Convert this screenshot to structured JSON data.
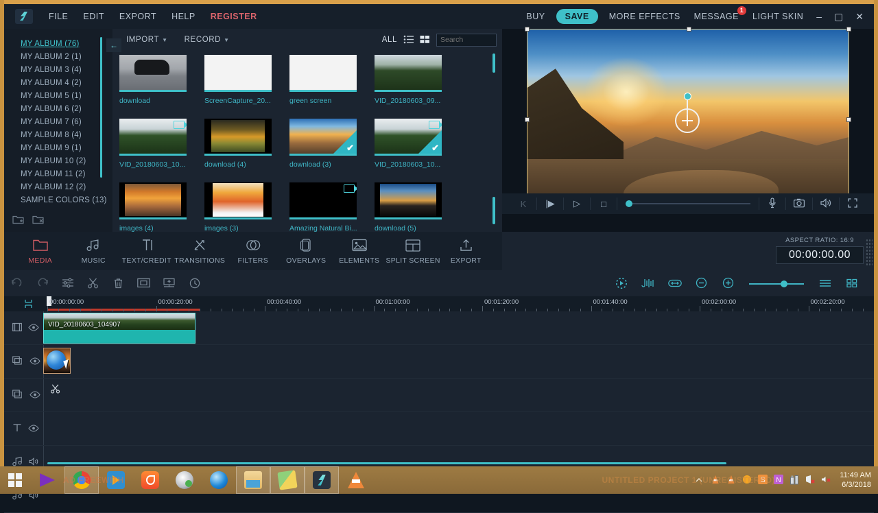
{
  "window": {
    "menu": [
      {
        "label": "FILE",
        "name": "menu-file"
      },
      {
        "label": "EDIT",
        "name": "menu-edit"
      },
      {
        "label": "EXPORT",
        "name": "menu-export"
      },
      {
        "label": "HELP",
        "name": "menu-help"
      },
      {
        "label": "REGISTER",
        "name": "menu-register"
      }
    ],
    "buy": "BUY",
    "save": "SAVE",
    "more_effects": "MORE EFFECTS",
    "message": "MESSAGE",
    "message_badge": "1",
    "light_skin": "LIGHT SKIN",
    "minimize": "–",
    "maximize": "▢",
    "close": "✕",
    "accent": "#3fc0c9",
    "register_color": "#d9636b"
  },
  "albums": {
    "items": [
      {
        "label": "MY ALBUM (76)",
        "active": true
      },
      {
        "label": "MY ALBUM 2 (1)",
        "active": false
      },
      {
        "label": "MY ALBUM 3 (4)",
        "active": false
      },
      {
        "label": "MY ALBUM 4 (2)",
        "active": false
      },
      {
        "label": "MY ALBUM 5 (1)",
        "active": false
      },
      {
        "label": "MY ALBUM 6 (2)",
        "active": false
      },
      {
        "label": "MY ALBUM 7 (6)",
        "active": false
      },
      {
        "label": "MY ALBUM 8 (4)",
        "active": false
      },
      {
        "label": "MY ALBUM 9 (1)",
        "active": false
      },
      {
        "label": "MY ALBUM 10 (2)",
        "active": false
      },
      {
        "label": "MY ALBUM 11 (2)",
        "active": false
      },
      {
        "label": "MY ALBUM 12 (2)",
        "active": false
      },
      {
        "label": "SAMPLE COLORS (13)",
        "active": false
      }
    ],
    "collapse_icon": "←",
    "add_album_icon": "new-album-icon",
    "remove_album_icon": "delete-album-icon"
  },
  "browser": {
    "import": "IMPORT",
    "record": "RECORD",
    "filter_all": "ALL",
    "list_view_icon": "list-view-icon",
    "grid_view_icon": "grid-view-icon",
    "search": {
      "value": "",
      "placeholder": "Search"
    },
    "items": [
      {
        "caption": "download",
        "art": "t-car",
        "video": false,
        "selected": false
      },
      {
        "caption": "ScreenCapture_20...",
        "art": "t-sheet",
        "video": false,
        "selected": false
      },
      {
        "caption": "green screen",
        "art": "t-sheet",
        "video": false,
        "selected": false
      },
      {
        "caption": "VID_20180603_09...",
        "art": "t-forest",
        "video": false,
        "selected": false
      },
      {
        "caption": "VID_20180603_10...",
        "art": "t-forest2",
        "video": true,
        "selected": false
      },
      {
        "caption": "download (4)",
        "art": "t-sunsetdark",
        "video": false,
        "selected": false
      },
      {
        "caption": "download (3)",
        "art": "t-canyon",
        "video": false,
        "selected": true
      },
      {
        "caption": "VID_20180603_10...",
        "art": "t-forest2",
        "video": true,
        "selected": true
      },
      {
        "caption": "images (4)",
        "art": "t-sea",
        "video": false,
        "selected": false
      },
      {
        "caption": "images (3)",
        "art": "t-bird",
        "video": false,
        "selected": false
      },
      {
        "caption": "Amazing Natural Bi...",
        "art": "t-black",
        "video": true,
        "selected": false
      },
      {
        "caption": "download (5)",
        "art": "t-night",
        "video": false,
        "selected": false
      }
    ]
  },
  "preview": {
    "pan_control_icon": "pan-crosshair-icon",
    "controls": [
      {
        "name": "jump-start-button",
        "glyph": "K",
        "dim": true
      },
      {
        "name": "jump-end-button",
        "glyph": "|▶",
        "dim": false
      },
      {
        "name": "play-button",
        "glyph": "▷",
        "dim": false
      },
      {
        "name": "stop-button",
        "glyph": "□",
        "dim": false
      }
    ],
    "mic_icon": "microphone-icon",
    "snapshot_icon": "camera-icon",
    "volume_icon": "speaker-icon",
    "fullscreen_icon": "fullscreen-icon",
    "seek_position_pct": 0
  },
  "tabs": [
    {
      "label": "MEDIA",
      "icon": "folder-icon",
      "active": true
    },
    {
      "label": "MUSIC",
      "icon": "music-note-icon",
      "active": false
    },
    {
      "label": "TEXT/CREDIT",
      "icon": "text-icon",
      "active": false
    },
    {
      "label": "TRANSITIONS",
      "icon": "transitions-icon",
      "active": false
    },
    {
      "label": "FILTERS",
      "icon": "filters-icon",
      "active": false
    },
    {
      "label": "OVERLAYS",
      "icon": "overlays-icon",
      "active": false
    },
    {
      "label": "ELEMENTS",
      "icon": "elements-icon",
      "active": false
    },
    {
      "label": "SPLIT SCREEN",
      "icon": "split-screen-icon",
      "active": false
    },
    {
      "label": "EXPORT",
      "icon": "export-icon",
      "active": false
    }
  ],
  "project": {
    "aspect_ratio_label": "ASPECT RATIO: 16:9",
    "timecode": "00:00:00.00"
  },
  "timeline_toolbar": {
    "left": [
      {
        "name": "undo-button",
        "icon": "undo-icon",
        "dim": true
      },
      {
        "name": "redo-button",
        "icon": "redo-icon",
        "dim": true
      },
      {
        "name": "adjust-button",
        "icon": "sliders-icon",
        "dim": false
      },
      {
        "name": "cut-button",
        "icon": "scissors-icon",
        "dim": false
      },
      {
        "name": "delete-button",
        "icon": "trash-icon",
        "dim": false
      },
      {
        "name": "crop-button",
        "icon": "crop-icon",
        "dim": false
      },
      {
        "name": "freeze-frame-button",
        "icon": "freeze-frame-icon",
        "dim": false
      },
      {
        "name": "duration-button",
        "icon": "clock-icon",
        "dim": false
      }
    ],
    "right": [
      {
        "name": "render-preview-button",
        "icon": "render-icon"
      },
      {
        "name": "audio-detach-button",
        "icon": "audio-wave-icon"
      },
      {
        "name": "fit-timeline-button",
        "icon": "fit-width-icon"
      },
      {
        "name": "zoom-out-button",
        "icon": "zoom-out-icon"
      },
      {
        "name": "zoom-in-button",
        "icon": "zoom-in-icon"
      }
    ],
    "zoom_value_pct": 58,
    "list-view": "list-lines-icon",
    "grid-view": "grid-squares-icon"
  },
  "ruler": {
    "labels": [
      "00:00:00:00",
      "00:00:20:00",
      "00:00:40:00",
      "00:01:00:00",
      "00:01:20:00",
      "00:01:40:00",
      "00:02:00:00",
      "00:02:20:00"
    ],
    "marker_icon": "marker-icon"
  },
  "timeline": {
    "tracks": [
      {
        "name": "video-track-1",
        "icon": "video-track-icon",
        "toggle": "eye-icon"
      },
      {
        "name": "overlay-track-1",
        "icon": "overlay-track-icon",
        "toggle": "eye-icon"
      },
      {
        "name": "overlay-track-2",
        "icon": "overlay-track-icon",
        "toggle": "eye-icon"
      },
      {
        "name": "text-track",
        "icon": "text-track-icon",
        "toggle": "eye-icon"
      },
      {
        "name": "audio-track-1",
        "icon": "audio-track-icon",
        "toggle": "speaker-icon"
      },
      {
        "name": "audio-track-2",
        "icon": "audio-track-icon",
        "toggle": "speaker-icon"
      }
    ],
    "video_clip_name": "VID_20180603_104907",
    "scissor_marker_icon": "scissors-icon"
  },
  "taskbar": {
    "start_icon": "windows-start-icon",
    "apps": [
      {
        "name": "taskbar-item-mediaplayer-purple",
        "icon": "purple-play-icon",
        "selected": false
      },
      {
        "name": "taskbar-item-chrome",
        "icon": "chrome-icon",
        "selected": true
      },
      {
        "name": "taskbar-item-wmp",
        "icon": "media-player-icon",
        "selected": false
      },
      {
        "name": "taskbar-item-uc-browser",
        "icon": "uc-browser-icon",
        "selected": false
      },
      {
        "name": "taskbar-item-kmplayer",
        "icon": "kmplayer-icon",
        "selected": false
      },
      {
        "name": "taskbar-item-internet-explorer",
        "icon": "internet-explorer-icon",
        "selected": false
      },
      {
        "name": "taskbar-item-file-explorer",
        "icon": "file-explorer-icon",
        "selected": true
      },
      {
        "name": "taskbar-item-photos",
        "icon": "photos-icon",
        "selected": true
      },
      {
        "name": "taskbar-item-filmora",
        "icon": "filmora-icon",
        "selected": true
      },
      {
        "name": "taskbar-item-vlc",
        "icon": "vlc-cone-icon",
        "selected": false
      }
    ],
    "tray": [
      {
        "name": "tray-show-hidden",
        "icon": "chevron-up-icon"
      },
      {
        "name": "tray-vlc-1",
        "icon": "vlc-cone-icon"
      },
      {
        "name": "tray-vlc-2",
        "icon": "vlc-cone-icon"
      },
      {
        "name": "tray-orange-dot",
        "icon": "circle-icon"
      },
      {
        "name": "tray-s-app",
        "icon": "s-letter-icon"
      },
      {
        "name": "tray-onenote",
        "icon": "onenote-icon"
      },
      {
        "name": "tray-usb",
        "icon": "usb-device-icon"
      },
      {
        "name": "tray-network",
        "icon": "network-error-icon"
      },
      {
        "name": "tray-volume",
        "icon": "volume-muted-icon"
      }
    ],
    "time": "11:49 AM",
    "date": "6/3/2018",
    "watermark": "AD FREEWITH",
    "watermark2": "UNTITLED PROJECT 1 (UNREGISTERED)"
  }
}
